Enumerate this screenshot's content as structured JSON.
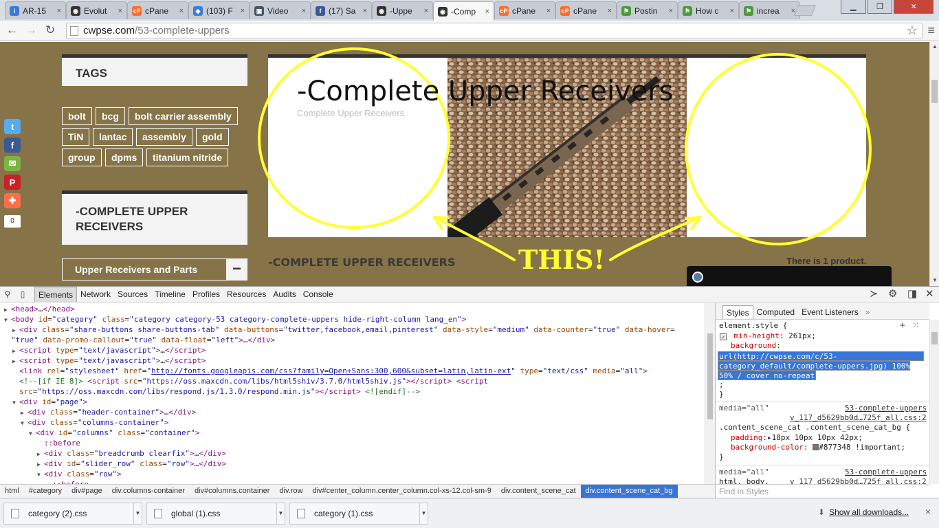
{
  "browser": {
    "tabs": [
      {
        "title": "AR-15",
        "color": "#3a7bd5",
        "glyph": "i"
      },
      {
        "title": "Evolut",
        "color": "#333333",
        "glyph": "◉"
      },
      {
        "title": "cPane",
        "color": "#ff6c2c",
        "glyph": "cP"
      },
      {
        "title": "(103) F",
        "color": "#3b7ddd",
        "glyph": "◆"
      },
      {
        "title": "Video",
        "color": "#456",
        "glyph": "▣"
      },
      {
        "title": "(17) Sa",
        "color": "#3b5998",
        "glyph": "f"
      },
      {
        "title": "-Uppe",
        "color": "#333333",
        "glyph": "◉"
      },
      {
        "title": "-Comp",
        "color": "#333333",
        "glyph": "◉",
        "active": true
      },
      {
        "title": "cPane",
        "color": "#ff6c2c",
        "glyph": "cP"
      },
      {
        "title": "cPane",
        "color": "#ff6c2c",
        "glyph": "cP"
      },
      {
        "title": "Postin",
        "color": "#4e9a3a",
        "glyph": "⚑"
      },
      {
        "title": "How c",
        "color": "#4e9a3a",
        "glyph": "⚑"
      },
      {
        "title": "increa",
        "color": "#4e9a3a",
        "glyph": "⚑"
      }
    ],
    "tab_close": "×",
    "url_host": "cwpse.com",
    "url_path": "/53-complete-uppers"
  },
  "site": {
    "share_counter": "0",
    "share_buttons": [
      {
        "name": "twitter",
        "color": "#55acee",
        "glyph": "t"
      },
      {
        "name": "facebook",
        "color": "#3b5998",
        "glyph": "f"
      },
      {
        "name": "email",
        "color": "#7cb342",
        "glyph": "✉"
      },
      {
        "name": "pinterest",
        "color": "#cb2027",
        "glyph": "P"
      },
      {
        "name": "share",
        "color": "#fe6d4c",
        "glyph": "✚"
      }
    ],
    "tags_title": "TAGS",
    "tags": [
      "bolt",
      "bcg",
      "bolt carrier assembly",
      "TiN",
      "lantac",
      "assembly",
      "gold",
      "group",
      "dpms",
      "titanium nitride"
    ],
    "category_title": "-COMPLETE UPPER RECEIVERS",
    "category_link": "Upper Receivers and Parts",
    "category_toggle": "−",
    "hero_title": "-Complete Upper Receivers",
    "hero_subtitle": "Complete Upper Receivers",
    "section_heading": "-COMPLETE UPPER RECEIVERS",
    "product_count": "There is 1 product.",
    "annotation_text": "THIS!",
    "annotation_color": "#ffff33"
  },
  "devtools": {
    "tabs": [
      "Elements",
      "Network",
      "Sources",
      "Timeline",
      "Profiles",
      "Resources",
      "Audits",
      "Console"
    ],
    "active_tab": "Elements",
    "elements": [
      {
        "indent": 0,
        "twisty": "▶",
        "html": "<span class=\"tg\">&lt;head&gt;</span>…<span class=\"tg\">&lt;/head&gt;</span>"
      },
      {
        "indent": 0,
        "twisty": "▼",
        "html": "<span class=\"tg\">&lt;body</span> <span class=\"at\">id</span>=<span class=\"av\">\"category\"</span> <span class=\"at\">class</span>=<span class=\"av\">\"category category-53 category-complete-uppers hide-right-column lang_en\"</span><span class=\"tg\">&gt;</span>"
      },
      {
        "indent": 1,
        "twisty": "▶",
        "html": "<span class=\"tg\">&lt;div</span> <span class=\"at\">class</span>=<span class=\"av\">\"share-buttons share-buttons-tab\"</span> <span class=\"at\">data-buttons</span>=<span class=\"av\">\"twitter,facebook,email,pinterest\"</span> <span class=\"at\">data-style</span>=<span class=\"av\">\"medium\"</span> <span class=\"at\">data-counter</span>=<span class=\"av\">\"true\"</span> <span class=\"at\">data-hover</span>="
      },
      {
        "indent": 0,
        "twisty": "",
        "html": "<span class=\"av\">\"true\"</span> <span class=\"at\">data-promo-callout</span>=<span class=\"av\">\"true\"</span> <span class=\"at\">data-float</span>=<span class=\"av\">\"left\"</span><span class=\"tg\">&gt;</span>…<span class=\"tg\">&lt;/div&gt;</span>"
      },
      {
        "indent": 1,
        "twisty": "▶",
        "html": "<span class=\"tg\">&lt;script</span> <span class=\"at\">type</span>=<span class=\"av\">\"text/javascript\"</span><span class=\"tg\">&gt;</span>…<span class=\"tg\">&lt;/script&gt;</span>"
      },
      {
        "indent": 1,
        "twisty": "▶",
        "html": "<span class=\"tg\">&lt;script</span> <span class=\"at\">type</span>=<span class=\"av\">\"text/javascript\"</span><span class=\"tg\">&gt;</span>…<span class=\"tg\">&lt;/script&gt;</span>"
      },
      {
        "indent": 1,
        "twisty": "",
        "html": "<span class=\"tg\">&lt;link</span> <span class=\"at\">rel</span>=<span class=\"av\">\"stylesheet\"</span> <span class=\"at\">href</span>=<span class=\"av\">\"<span class=\"lk\">http://fonts.googleapis.com/css?family=Open+Sans:300,600&amp;subset=latin,latin-ext</span>\"</span> <span class=\"at\">type</span>=<span class=\"av\">\"text/css\"</span> <span class=\"at\">media</span>=<span class=\"av\">\"all\"</span><span class=\"tg\">&gt;</span>"
      },
      {
        "indent": 1,
        "twisty": "",
        "html": "<span class=\"cm\">&lt;!--[if IE 8]&gt;</span> <span class=\"tg\">&lt;script</span> <span class=\"at\">src</span>=<span class=\"av\">\"https://oss.maxcdn.com/libs/html5shiv/3.7.0/html5shiv.js\"</span><span class=\"tg\">&gt;&lt;/script&gt;</span> <span class=\"tg\">&lt;script</span>"
      },
      {
        "indent": 1,
        "twisty": "",
        "html": "<span class=\"at\">src</span>=<span class=\"av\">\"https://oss.maxcdn.com/libs/respond.js/1.3.0/respond.min.js\"</span><span class=\"tg\">&gt;&lt;/script&gt;</span> <span class=\"cm\">&lt;![endif]--&gt;</span>"
      },
      {
        "indent": 1,
        "twisty": "▼",
        "html": "<span class=\"tg\">&lt;div</span> <span class=\"at\">id</span>=<span class=\"av\">\"page\"</span><span class=\"tg\">&gt;</span>"
      },
      {
        "indent": 2,
        "twisty": "▶",
        "html": "<span class=\"tg\">&lt;div</span> <span class=\"at\">class</span>=<span class=\"av\">\"header-container\"</span><span class=\"tg\">&gt;</span>…<span class=\"tg\">&lt;/div&gt;</span>"
      },
      {
        "indent": 2,
        "twisty": "▼",
        "html": "<span class=\"tg\">&lt;div</span> <span class=\"at\">class</span>=<span class=\"av\">\"columns-container\"</span><span class=\"tg\">&gt;</span>"
      },
      {
        "indent": 3,
        "twisty": "▼",
        "html": "<span class=\"tg\">&lt;div</span> <span class=\"at\">id</span>=<span class=\"av\">\"columns\"</span> <span class=\"at\">class</span>=<span class=\"av\">\"container\"</span><span class=\"tg\">&gt;</span>"
      },
      {
        "indent": 4,
        "twisty": "",
        "html": "<span class=\"pu\">::before</span>"
      },
      {
        "indent": 4,
        "twisty": "▶",
        "html": "<span class=\"tg\">&lt;div</span> <span class=\"at\">class</span>=<span class=\"av\">\"breadcrumb clearfix\"</span><span class=\"tg\">&gt;</span>…<span class=\"tg\">&lt;/div&gt;</span>"
      },
      {
        "indent": 4,
        "twisty": "▶",
        "html": "<span class=\"tg\">&lt;div</span> <span class=\"at\">id</span>=<span class=\"av\">\"slider_row\"</span> <span class=\"at\">class</span>=<span class=\"av\">\"row\"</span><span class=\"tg\">&gt;</span>…<span class=\"tg\">&lt;/div&gt;</span>"
      },
      {
        "indent": 4,
        "twisty": "▼",
        "html": "<span class=\"tg\">&lt;div</span> <span class=\"at\">class</span>=<span class=\"av\">\"row\"</span><span class=\"tg\">&gt;</span>"
      },
      {
        "indent": 5,
        "twisty": "",
        "html": "<span class=\"pu\">::before</span>"
      }
    ],
    "styles_tabs": [
      "Styles",
      "Computed",
      "Event Listeners"
    ],
    "styles_more": "»",
    "element_style_selector": "element.style {",
    "min_height_prop": "min-height",
    "min_height_value": "261px;",
    "background_prop": "background",
    "background_value_lines": [
      "url(http://cwpse.com/c/53-",
      "category_default/complete-uppers.jpg) 100%",
      "50% / cover no-repeat"
    ],
    "rule1_media": "media=\"all\"",
    "rule1_source": "53-complete-uppers",
    "rule1_source_file": "v_117_d5629bb0d…725f_all.css:2",
    "rule1_selector": ".content_scene_cat .content_scene_cat_bg {",
    "rule1_props": [
      {
        "prop": "padding",
        "value": "▸18px 10px 10px 42px;"
      },
      {
        "prop": "background-color",
        "value": "#877348 !important;"
      }
    ],
    "rule2_media": "media=\"all\"",
    "rule2_source": "53-complete-uppers",
    "rule2_selector": "html, body,",
    "rule2_source_file": "v_117_d5629bb0d…725f_all.css:2",
    "breadcrumbs": [
      "html",
      "#category",
      "div#page",
      "div.columns-container",
      "div#columns.container",
      "div.row",
      "div#center_column.center_column.col-xs-12.col-sm-9",
      "div.content_scene_cat",
      "div.content_scene_cat_bg"
    ],
    "find_in_styles": "Find in Styles"
  },
  "downloads": {
    "items": [
      "category (2).css",
      "global (1).css",
      "category (1).css"
    ],
    "show_all": "Show all downloads...",
    "close": "×"
  }
}
